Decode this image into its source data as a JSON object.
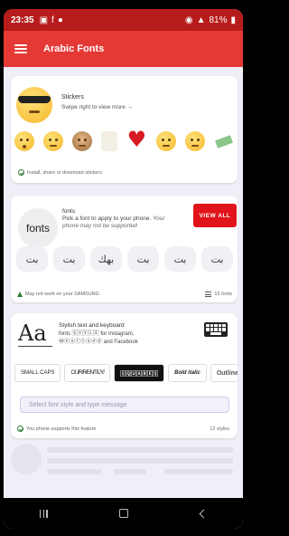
{
  "status_bar": {
    "time": "23:35",
    "battery": "81%"
  },
  "app_bar": {
    "title": "Arabic Fonts"
  },
  "stickers_card": {
    "title": "Stickers",
    "subtitle": "Swipe right to view more →",
    "footer": "Install, share or download stickers"
  },
  "fonts_card": {
    "badge": "fonts",
    "title": "fonts",
    "description": "Pick a font to apply to your phone.",
    "warning": "Your phone may not be supported",
    "view_all_label": "VIEW ALL",
    "samples": [
      "بت",
      "بت",
      "بهك",
      "بت",
      "بت",
      "بت"
    ],
    "footer_left": "May not work on your SAMSUNG",
    "footer_right": "15 fonts"
  },
  "styles_card": {
    "title": "Stylish text and keyboard",
    "description": "fonts 🅂🅃🅈🄻🄴 for Instagram, Ⓦⓗⓐⓣⓢⓐⓟⓟ and Facebook",
    "chips": [
      "SMALL CAPS",
      "C̸U̸R̸R̸E̸N̸T̸L̸Y̸",
      "🅂🅀🅄🄰🅁🄴🅂",
      "Bold italic",
      "Outline"
    ],
    "search_placeholder": "Select font style and type message",
    "footer_left": "You phone supports this feature",
    "footer_right": "12 styles"
  }
}
